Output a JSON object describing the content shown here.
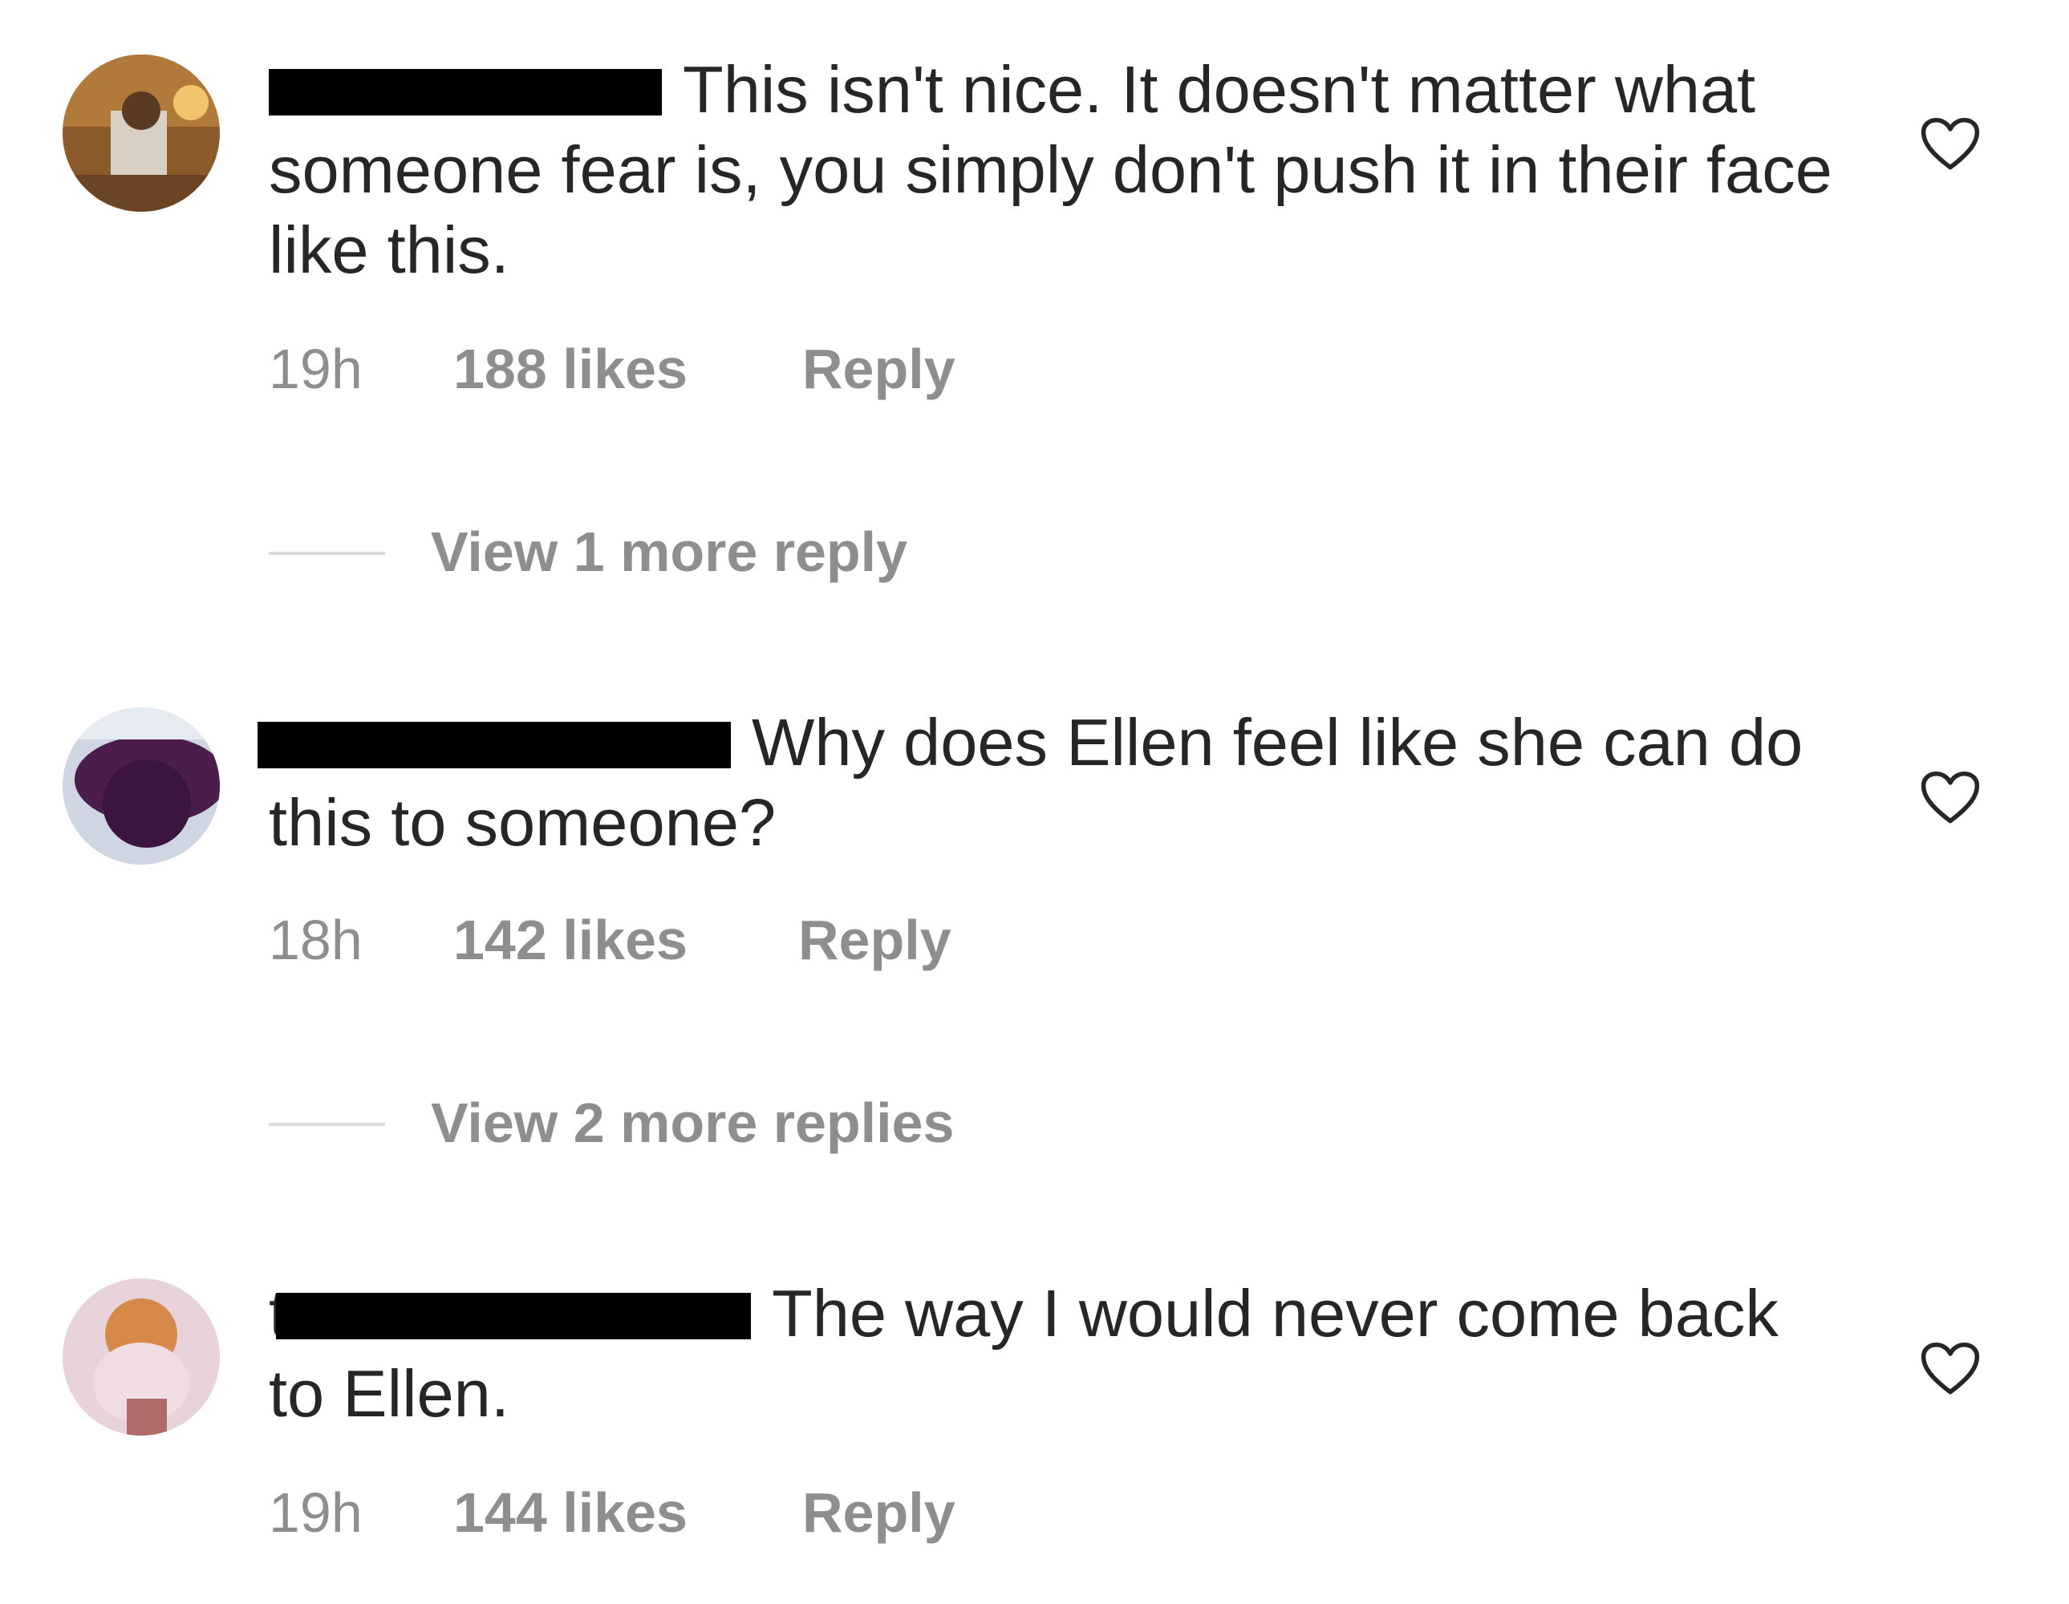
{
  "comments": [
    {
      "text": "This isn't nice. It doesn't matter what someone fear is, you simply don't push it in their face like this.",
      "time": "19h",
      "likes": "188 likes",
      "reply": "Reply",
      "view_more": "View 1 more reply"
    },
    {
      "text": "Why does Ellen feel like she can do this to someone?",
      "time": "18h",
      "likes": "142 likes",
      "reply": "Reply",
      "view_more": "View 2 more replies"
    },
    {
      "username_visible_start": "t",
      "text": "The way I would never come back to Ellen.",
      "time": "19h",
      "likes": "144 likes",
      "reply": "Reply"
    }
  ],
  "colors": {
    "text": "#262626",
    "meta": "#8e8e8e",
    "divider": "#dbdbdb"
  },
  "icons": {
    "like": "heart-outline-icon"
  }
}
